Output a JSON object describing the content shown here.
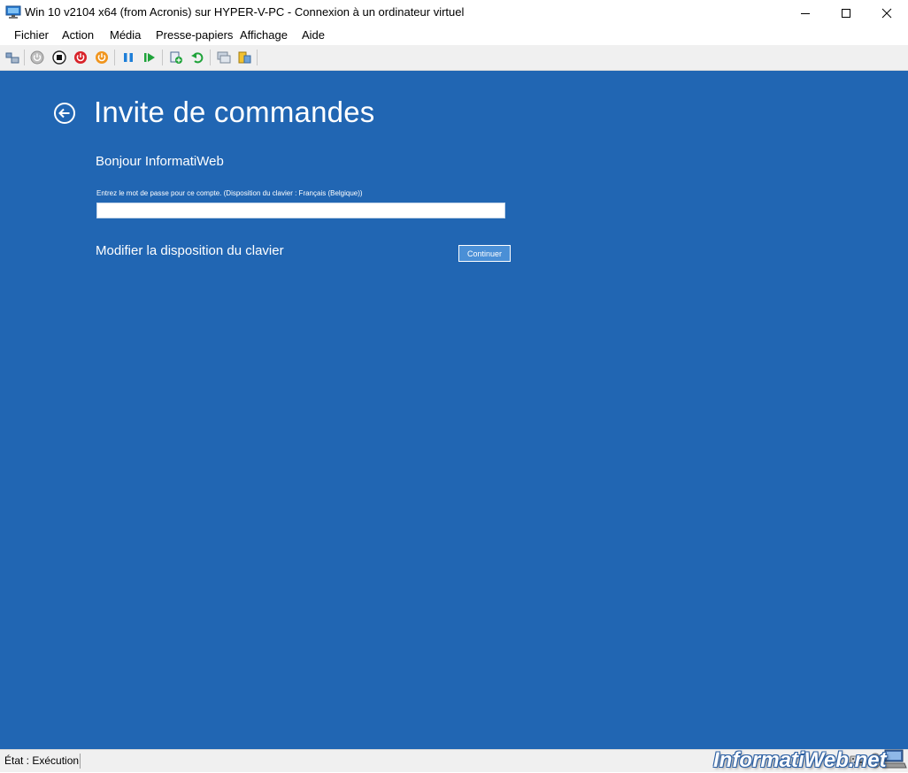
{
  "window": {
    "title": "Win 10 v2104 x64 (from Acronis) sur HYPER-V-PC - Connexion à un ordinateur virtuel"
  },
  "menu": {
    "items": [
      "Fichier",
      "Action",
      "Média",
      "Presse-papiers",
      "Affichage",
      "Aide"
    ]
  },
  "toolbar": {
    "icons": [
      "ctrl-alt-del-icon",
      "start-icon",
      "turn-off-icon",
      "shutdown-icon",
      "save-icon",
      "pause-icon",
      "resume-icon",
      "checkpoint-icon",
      "revert-icon",
      "enhanced-session-icon",
      "share-icon"
    ]
  },
  "vm": {
    "page_title": "Invite de commandes",
    "greeting": "Bonjour InformatiWeb",
    "password_label": "Entrez le mot de passe pour ce compte. (Disposition du clavier : Français (Belgique))",
    "password_value": "",
    "keyboard_link": "Modifier la disposition du clavier",
    "continue_label": "Continuer",
    "background_color": "#2166b3"
  },
  "status": {
    "text": "État : Exécution",
    "watermark": "InformatiWeb.net"
  }
}
